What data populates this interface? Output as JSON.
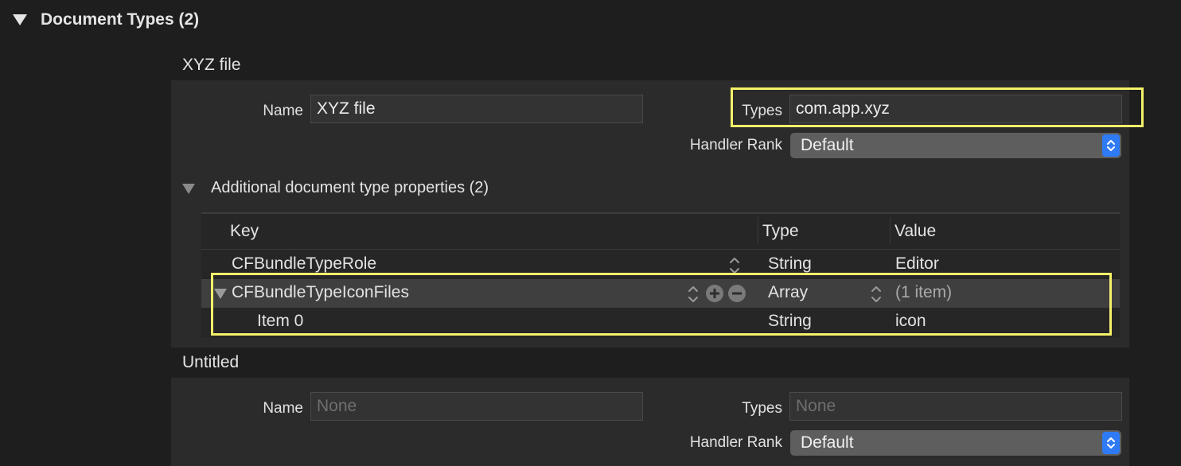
{
  "section": {
    "title": "Document Types (2)"
  },
  "documents": [
    {
      "title": "XYZ  file",
      "name_label": "Name",
      "name_value": "XYZ  file",
      "types_label": "Types",
      "types_value": "com.app.xyz",
      "handler_rank_label": "Handler Rank",
      "handler_rank_value": "Default",
      "additional": {
        "title": "Additional document type properties (2)",
        "columns": [
          "Key",
          "Type",
          "Value"
        ],
        "rows": [
          {
            "key": "CFBundleTypeRole",
            "type": "String",
            "value": "Editor"
          },
          {
            "key": "CFBundleTypeIconFiles",
            "type": "Array",
            "value": "(1 item)"
          },
          {
            "key": "Item 0",
            "type": "String",
            "value": "icon"
          }
        ]
      }
    },
    {
      "title": "Untitled",
      "name_label": "Name",
      "name_placeholder": "None",
      "types_label": "Types",
      "types_placeholder": "None",
      "handler_rank_label": "Handler Rank",
      "handler_rank_value": "Default"
    }
  ],
  "colors": {
    "highlight": "#f4f16a",
    "popup_accent": "#2f7bf5",
    "background": "#1e1e1e"
  }
}
